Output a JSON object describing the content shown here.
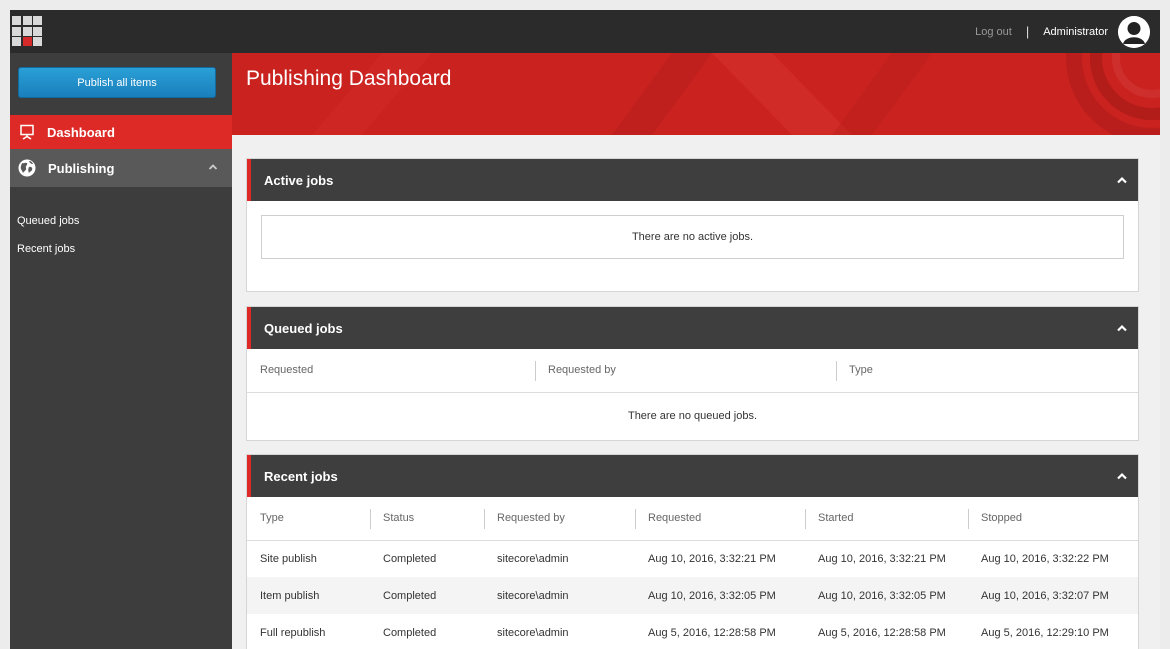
{
  "topbar": {
    "logout": "Log out",
    "separator": "|",
    "user": "Administrator"
  },
  "sidebar": {
    "publish_button": "Publish all items",
    "dashboard": "Dashboard",
    "publishing": "Publishing",
    "sub_items": [
      "Queued jobs",
      "Recent jobs"
    ]
  },
  "main": {
    "title": "Publishing Dashboard",
    "active": {
      "title": "Active jobs",
      "empty": "There are no active jobs."
    },
    "queued": {
      "title": "Queued jobs",
      "columns": [
        "Requested",
        "Requested by",
        "Type"
      ],
      "empty": "There are no queued jobs."
    },
    "recent": {
      "title": "Recent jobs",
      "columns": [
        "Type",
        "Status",
        "Requested by",
        "Requested",
        "Started",
        "Stopped"
      ],
      "rows": [
        [
          "Site publish",
          "Completed",
          "sitecore\\admin",
          "Aug 10, 2016, 3:32:21 PM",
          "Aug 10, 2016, 3:32:21 PM",
          "Aug 10, 2016, 3:32:22 PM"
        ],
        [
          "Item publish",
          "Completed",
          "sitecore\\admin",
          "Aug 10, 2016, 3:32:05 PM",
          "Aug 10, 2016, 3:32:05 PM",
          "Aug 10, 2016, 3:32:07 PM"
        ],
        [
          "Full republish",
          "Completed",
          "sitecore\\admin",
          "Aug 5, 2016, 12:28:58 PM",
          "Aug 5, 2016, 12:28:58 PM",
          "Aug 5, 2016, 12:29:10 PM"
        ]
      ]
    }
  },
  "colors": {
    "accent_red": "#dd2a27",
    "button_blue": "#1a7fbc",
    "topbar": "#2b2b2b",
    "sidebar": "#3d3d3d",
    "panel_header": "#3e3e3e"
  },
  "icons": [
    "app-grid-icon",
    "avatar-icon",
    "dashboard-icon",
    "globe-icon",
    "chevron-up-icon"
  ]
}
